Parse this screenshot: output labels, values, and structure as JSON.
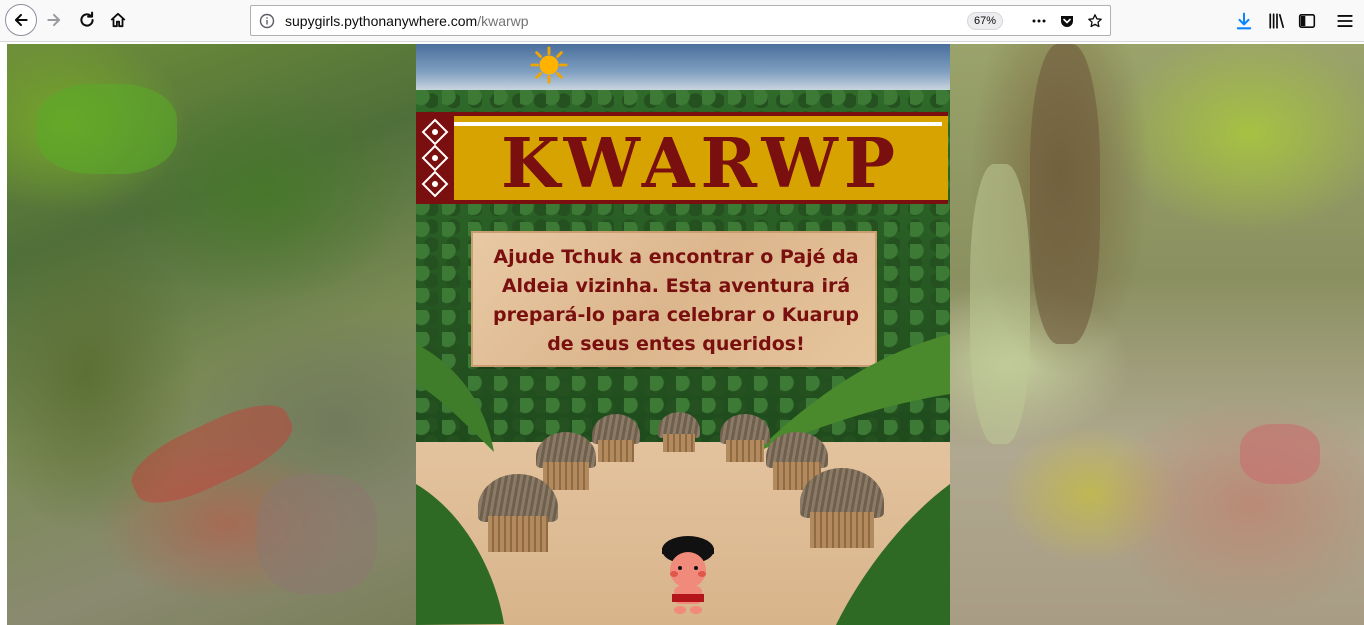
{
  "browser": {
    "url_host": "supygirls.pythonanywhere.com",
    "url_path": "/kwarwp",
    "zoom_label": "67%",
    "icons": [
      "back-arrow-icon",
      "forward-arrow-icon",
      "reload-icon",
      "home-icon",
      "info-icon",
      "more-dots-icon",
      "pocket-icon",
      "bookmark-star-icon",
      "download-icon",
      "library-icon",
      "sidebar-icon",
      "menu-icon"
    ]
  },
  "game": {
    "title": "KWARWP",
    "sign_text": "Ajude Tchuk a encontrar o Pajé da Aldeia vizinha. Esta aventura  irá prepará-lo para celebrar o Kuarup de seus entes queridos!"
  },
  "colors": {
    "banner_bg": "#d6a300",
    "banner_red": "#7a0f0f",
    "sign_bg": "#e3c39e",
    "sign_text": "#7a0f0f"
  }
}
